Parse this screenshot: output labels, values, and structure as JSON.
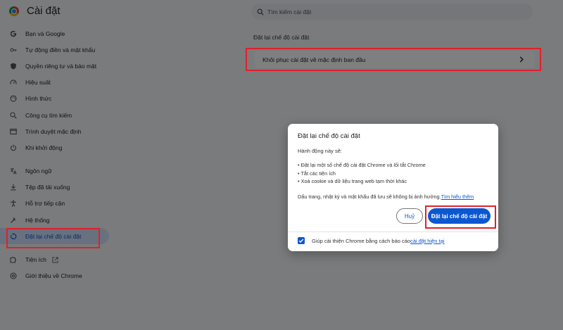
{
  "header": {
    "title": "Cài đặt",
    "search_placeholder": "Tìm kiếm cài đặt"
  },
  "sidebar": {
    "items": [
      {
        "label": "Bạn và Google",
        "icon": "google-icon"
      },
      {
        "label": "Tự động điền và mật khẩu",
        "icon": "key-icon"
      },
      {
        "label": "Quyền riêng tư và bảo mật",
        "icon": "shield-icon"
      },
      {
        "label": "Hiệu suất",
        "icon": "speedometer-icon"
      },
      {
        "label": "Hình thức",
        "icon": "palette-icon"
      },
      {
        "label": "Công cụ tìm kiếm",
        "icon": "search-icon"
      },
      {
        "label": "Trình duyệt mặc định",
        "icon": "browser-icon"
      },
      {
        "label": "Khi khởi động",
        "icon": "power-icon"
      },
      {
        "label": "Ngôn ngữ",
        "icon": "translate-icon"
      },
      {
        "label": "Tệp đã tải xuống",
        "icon": "download-icon"
      },
      {
        "label": "Hỗ trợ tiếp cận",
        "icon": "accessibility-icon"
      },
      {
        "label": "Hệ thống",
        "icon": "wrench-icon"
      },
      {
        "label": "Đặt lại chế độ cài đặt",
        "icon": "reset-icon"
      },
      {
        "label": "Tiện ích",
        "icon": "puzzle-icon"
      },
      {
        "label": "Giới thiệu về Chrome",
        "icon": "chrome-icon"
      }
    ],
    "active_index": 12
  },
  "main": {
    "section_title": "Đặt lại chế độ cài đặt",
    "reset_row_label": "Khôi phục cài đặt về mặc định ban đầu"
  },
  "dialog": {
    "title": "Đặt lại chế độ cài đặt",
    "intro": "Hành động này sẽ:",
    "bullets": [
      "Đặt lại một số chế độ cài đặt Chrome và lối tắt Chrome",
      "Tắt các tiện ích",
      "Xoá cookie và dữ liệu trang web tạm thời khác"
    ],
    "note": "Dấu trang, nhật ký và mật khẩu đã lưu sẽ không bị ảnh hưởng.",
    "learn_more": "Tìm hiểu thêm",
    "cancel_label": "Huỷ",
    "reset_label": "Đặt lại chế độ cài đặt",
    "footer_text": "Giúp cải thiện Chrome bằng cách báo cáo ",
    "footer_link": "cài đặt hiện tại",
    "footer_checked": true
  },
  "colors": {
    "accent": "#0b57d0",
    "annotation": "#e0202a",
    "active_bg": "#d3e3fd"
  }
}
